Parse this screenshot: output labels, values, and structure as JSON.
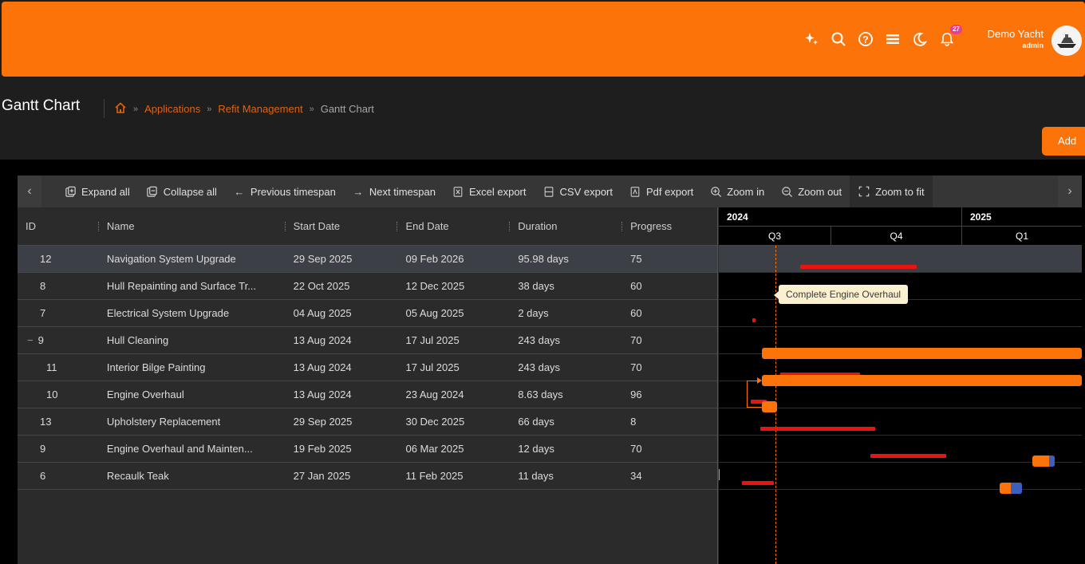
{
  "header": {
    "notification_count": "27",
    "user_name": "Demo Yacht",
    "user_role": "admin",
    "icons": [
      "sparkle-icon",
      "search-icon",
      "help-icon",
      "menu-icon",
      "moon-icon",
      "bell-icon"
    ]
  },
  "page": {
    "title": "Gantt Chart",
    "breadcrumb": [
      "Applications",
      "Refit Management",
      "Gantt Chart"
    ],
    "add_label": "Add"
  },
  "toolbar": {
    "expand_all": "Expand all",
    "collapse_all": "Collapse all",
    "previous_timespan": "Previous timespan",
    "next_timespan": "Next timespan",
    "excel_export": "Excel export",
    "csv_export": "CSV export",
    "pdf_export": "Pdf export",
    "zoom_in": "Zoom in",
    "zoom_out": "Zoom out",
    "zoom_to_fit": "Zoom to fit"
  },
  "grid": {
    "columns": [
      "ID",
      "Name",
      "Start Date",
      "End Date",
      "Duration",
      "Progress"
    ],
    "rows": [
      {
        "id": "12",
        "name": "Navigation System Upgrade",
        "start": "29 Sep 2025",
        "end": "09 Feb 2026",
        "duration": "95.98 days",
        "progress": "75"
      },
      {
        "id": "8",
        "name": "Hull Repainting and Surface Tr...",
        "start": "22 Oct 2025",
        "end": "12 Dec 2025",
        "duration": "38 days",
        "progress": "60"
      },
      {
        "id": "7",
        "name": "Electrical System Upgrade",
        "start": "04 Aug 2025",
        "end": "05 Aug 2025",
        "duration": "2 days",
        "progress": "60"
      },
      {
        "id": "9",
        "name": "Hull Cleaning",
        "start": "13 Aug 2024",
        "end": "17 Jul 2025",
        "duration": "243 days",
        "progress": "70"
      },
      {
        "id": "11",
        "name": "Interior Bilge Painting",
        "start": "13 Aug 2024",
        "end": "17 Jul 2025",
        "duration": "243 days",
        "progress": "70"
      },
      {
        "id": "10",
        "name": "Engine Overhaul",
        "start": "13 Aug 2024",
        "end": "23 Aug 2024",
        "duration": "8.63 days",
        "progress": "96"
      },
      {
        "id": "13",
        "name": "Upholstery Replacement",
        "start": "29 Sep 2025",
        "end": "30 Dec 2025",
        "duration": "66 days",
        "progress": "8"
      },
      {
        "id": "9",
        "name": "Engine Overhaul and Mainten...",
        "start": "19 Feb 2025",
        "end": "06 Mar 2025",
        "duration": "12 days",
        "progress": "70"
      },
      {
        "id": "6",
        "name": "Recaulk Teak",
        "start": "27 Jan 2025",
        "end": "11 Feb 2025",
        "duration": "11 days",
        "progress": "34"
      }
    ]
  },
  "timeline": {
    "years": [
      "2024",
      "2025"
    ],
    "quarters": [
      "Q3",
      "Q4",
      "Q1"
    ],
    "tooltip": "Complete Engine Overhaul"
  },
  "colors": {
    "brand": "#fb7309",
    "baseline": "#e8140f",
    "progress_fill": "#3a5fbf"
  }
}
